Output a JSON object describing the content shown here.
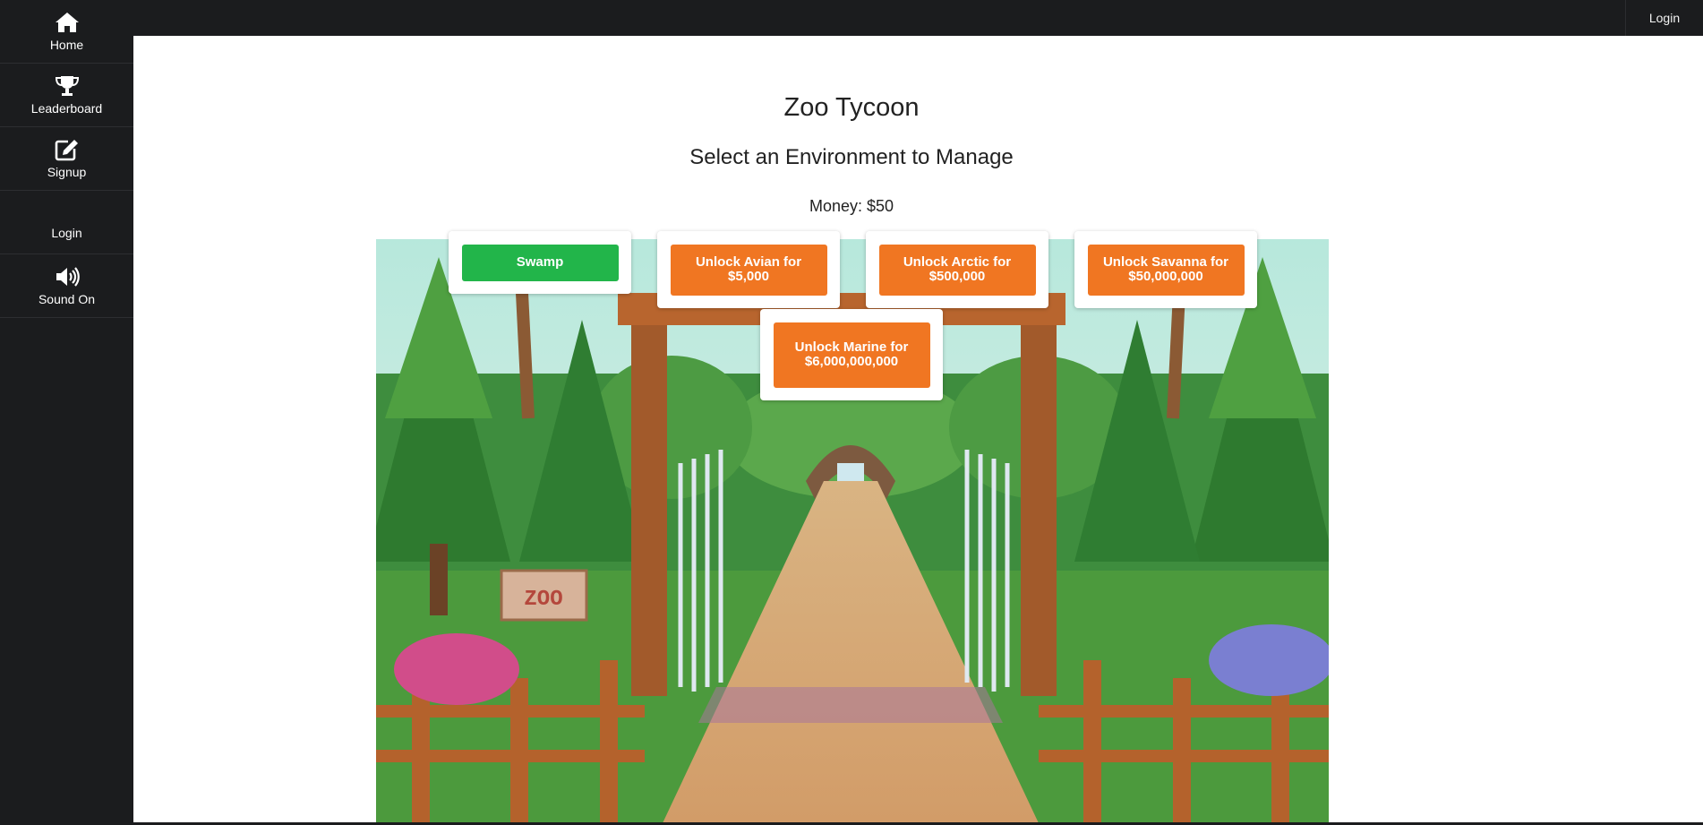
{
  "topbar": {
    "login_label": "Login"
  },
  "sidebar": {
    "items": [
      {
        "label": "Home",
        "icon": "home-icon"
      },
      {
        "label": "Leaderboard",
        "icon": "trophy-icon"
      },
      {
        "label": "Signup",
        "icon": "edit-icon"
      },
      {
        "label": "Login",
        "icon": ""
      },
      {
        "label": "Sound On",
        "icon": "speaker-icon"
      }
    ]
  },
  "main": {
    "title": "Zoo Tycoon",
    "subtitle": "Select an Environment to Manage",
    "money": "Money: $50",
    "environments": [
      {
        "label": "Swamp",
        "state": "unlocked",
        "color": "#22b54a"
      },
      {
        "label": "Unlock Avian for $5,000",
        "state": "locked",
        "color": "#f07622"
      },
      {
        "label": "Unlock Arctic for $500,000",
        "state": "locked",
        "color": "#f07622"
      },
      {
        "label": "Unlock Savanna for $50,000,000",
        "state": "locked",
        "color": "#f07622"
      },
      {
        "label": "Unlock Marine for $6,000,000,000",
        "state": "locked",
        "color": "#f07622"
      }
    ],
    "sign_text": "ZOO"
  },
  "colors": {
    "sidebar_bg": "#1b1c1e",
    "unlocked": "#22b54a",
    "locked": "#f07622"
  }
}
